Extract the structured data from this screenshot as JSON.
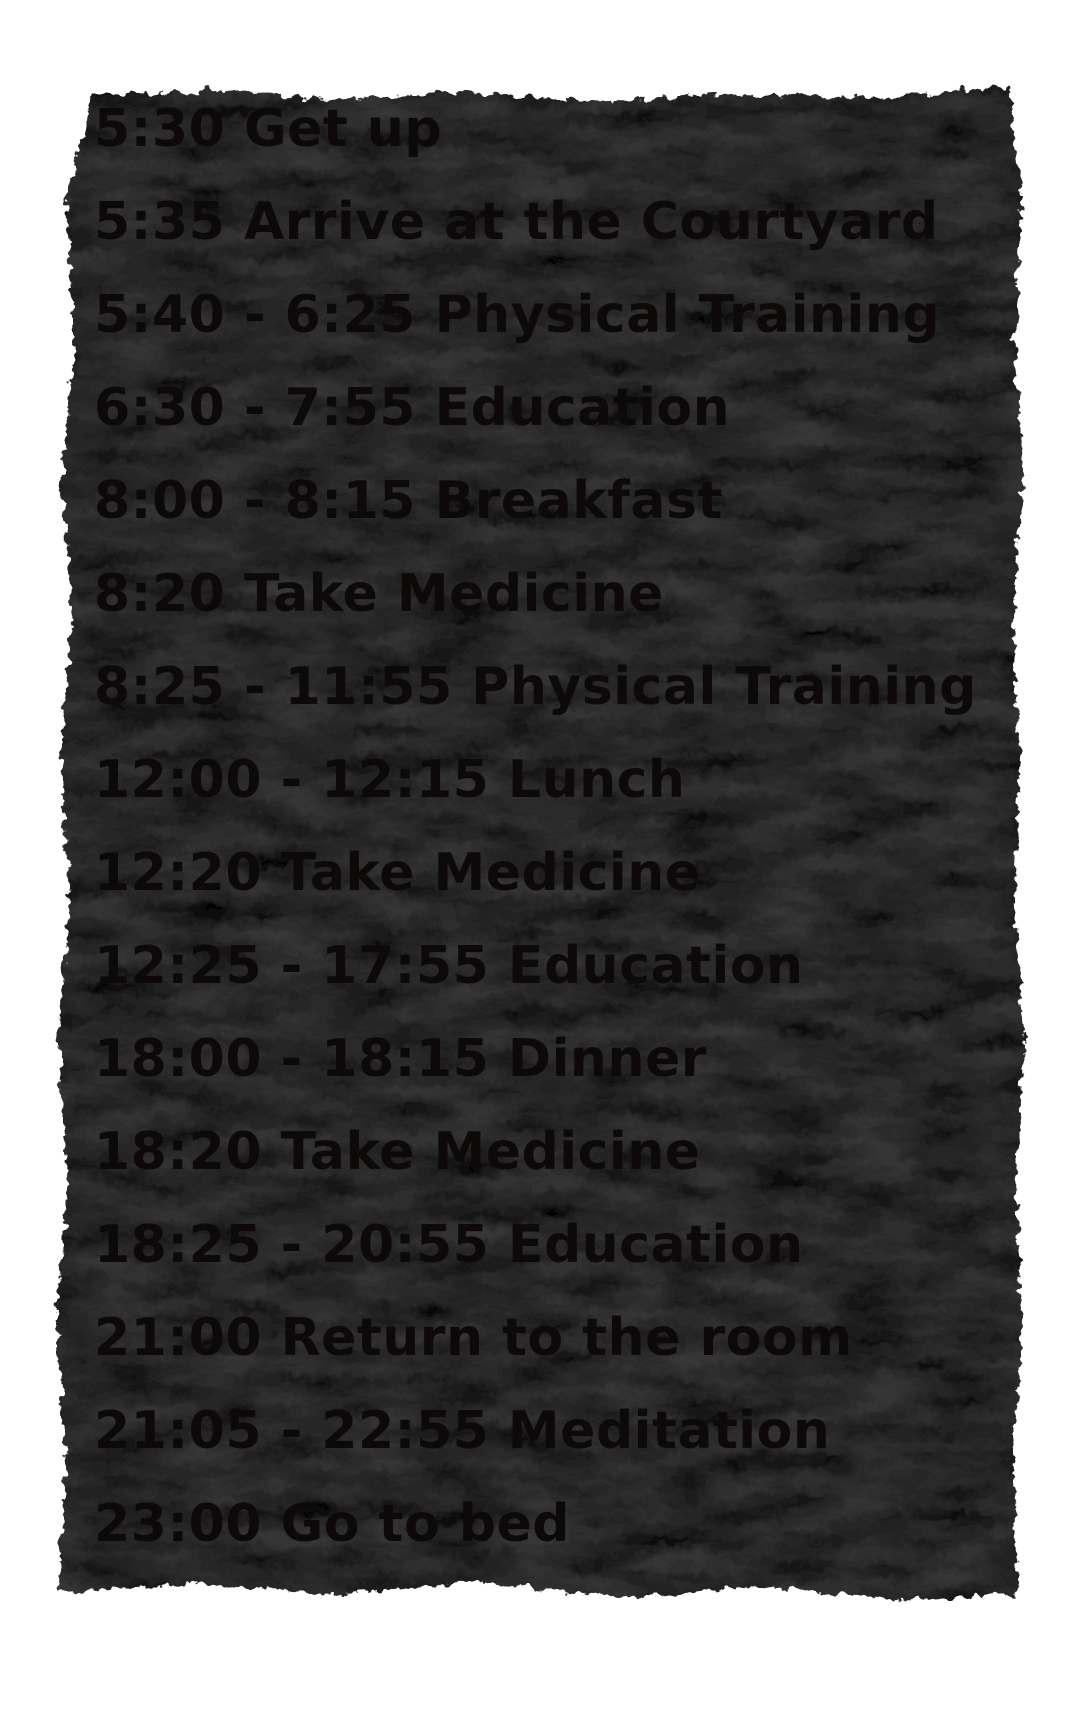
{
  "paper": {
    "background_color": "#ffffff",
    "paper_color": "#0a0a0a",
    "text_color": "#0d0909"
  },
  "schedule": [
    "5:30 Get up",
    "5:35 Arrive at the Courtyard",
    "5:40 - 6:25 Physical Training",
    "6:30 - 7:55 Education",
    "8:00 - 8:15 Breakfast",
    "8:20 Take Medicine",
    "8:25 - 11:55 Physical Training",
    "12:00 - 12:15 Lunch",
    "12:20 Take Medicine",
    "12:25 - 17:55 Education",
    "18:00 - 18:15 Dinner",
    "18:20 Take Medicine",
    "18:25 - 20:55 Education",
    "21:00 Return to the room",
    "21:05 - 22:55 Meditation",
    "23:00 Go to bed"
  ]
}
